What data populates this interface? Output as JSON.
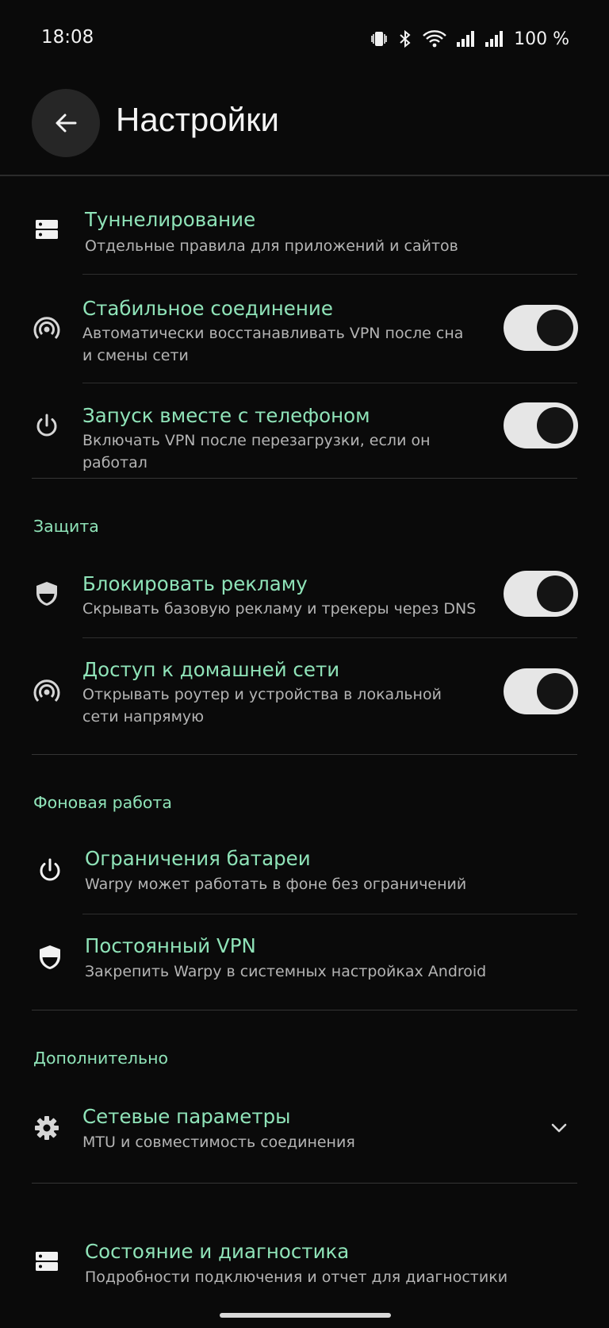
{
  "status_bar": {
    "time": "18:08",
    "battery": "100 %"
  },
  "app_bar": {
    "title": "Настройки"
  },
  "items": {
    "tunneling": {
      "title": "Туннелирование",
      "subtitle": "Отдельные правила для приложений и сайтов",
      "icon": "server-icon"
    },
    "stable_connection": {
      "title": "Стабильное соединение",
      "subtitle": "Автоматически восстанавливать VPN после сна и смены сети",
      "icon": "broadcast-icon",
      "enabled": true
    },
    "start_with_phone": {
      "title": "Запуск вместе с телефоном",
      "subtitle": "Включать VPN после перезагрузки, если он работал",
      "icon": "power-icon",
      "enabled": true
    },
    "block_ads": {
      "title": "Блокировать рекламу",
      "subtitle": "Скрывать базовую рекламу и трекеры через DNS",
      "icon": "shield-icon",
      "enabled": true
    },
    "home_network": {
      "title": "Доступ к домашней сети",
      "subtitle": "Открывать роутер и устройства в локальной сети напрямую",
      "icon": "broadcast-icon",
      "enabled": true
    },
    "battery_limits": {
      "title": "Ограничения батареи",
      "subtitle": "Warpy может работать в фоне без ограничений",
      "icon": "power-icon"
    },
    "always_on_vpn": {
      "title": "Постоянный VPN",
      "subtitle": "Закрепить Warpy в системных настройках Android",
      "icon": "shield-icon"
    },
    "network_params": {
      "title": "Сетевые параметры",
      "subtitle": "MTU и совместимость соединения",
      "icon": "gear-icon"
    },
    "diagnostics": {
      "title": "Состояние и диагностика",
      "subtitle": "Подробности подключения и отчет для диагностики",
      "icon": "server-icon"
    }
  },
  "sections": {
    "protection": "Защита",
    "background": "Фоновая работа",
    "advanced": "Дополнительно"
  },
  "colors": {
    "accent": "#8fe3b8",
    "background": "#0a0a0a",
    "toggle_track": "#e6e6e6"
  }
}
